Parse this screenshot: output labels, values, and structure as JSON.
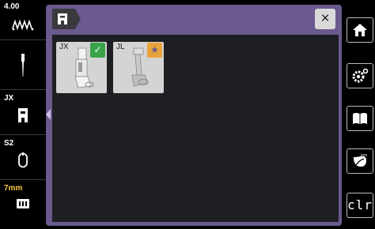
{
  "left_bar": {
    "stitch_width_value": "4.00",
    "presser_foot_label": "JX",
    "stitch_plate_label": "S2",
    "thread_length_label": "7mm"
  },
  "dialog": {
    "close_glyph": "×",
    "feet": [
      {
        "code": "JX",
        "badge": "check",
        "badge_color": "#3aa34a",
        "badge_glyph": "✓"
      },
      {
        "code": "JL",
        "badge": "star",
        "badge_color": "#e8a43a",
        "badge_glyph": "★"
      }
    ]
  },
  "right_bar": {
    "home_icon": "home-icon",
    "settings_icon": "settings-icon",
    "manual_icon": "book-icon",
    "eco_icon": "eco-icon",
    "clear_label": "clr"
  }
}
